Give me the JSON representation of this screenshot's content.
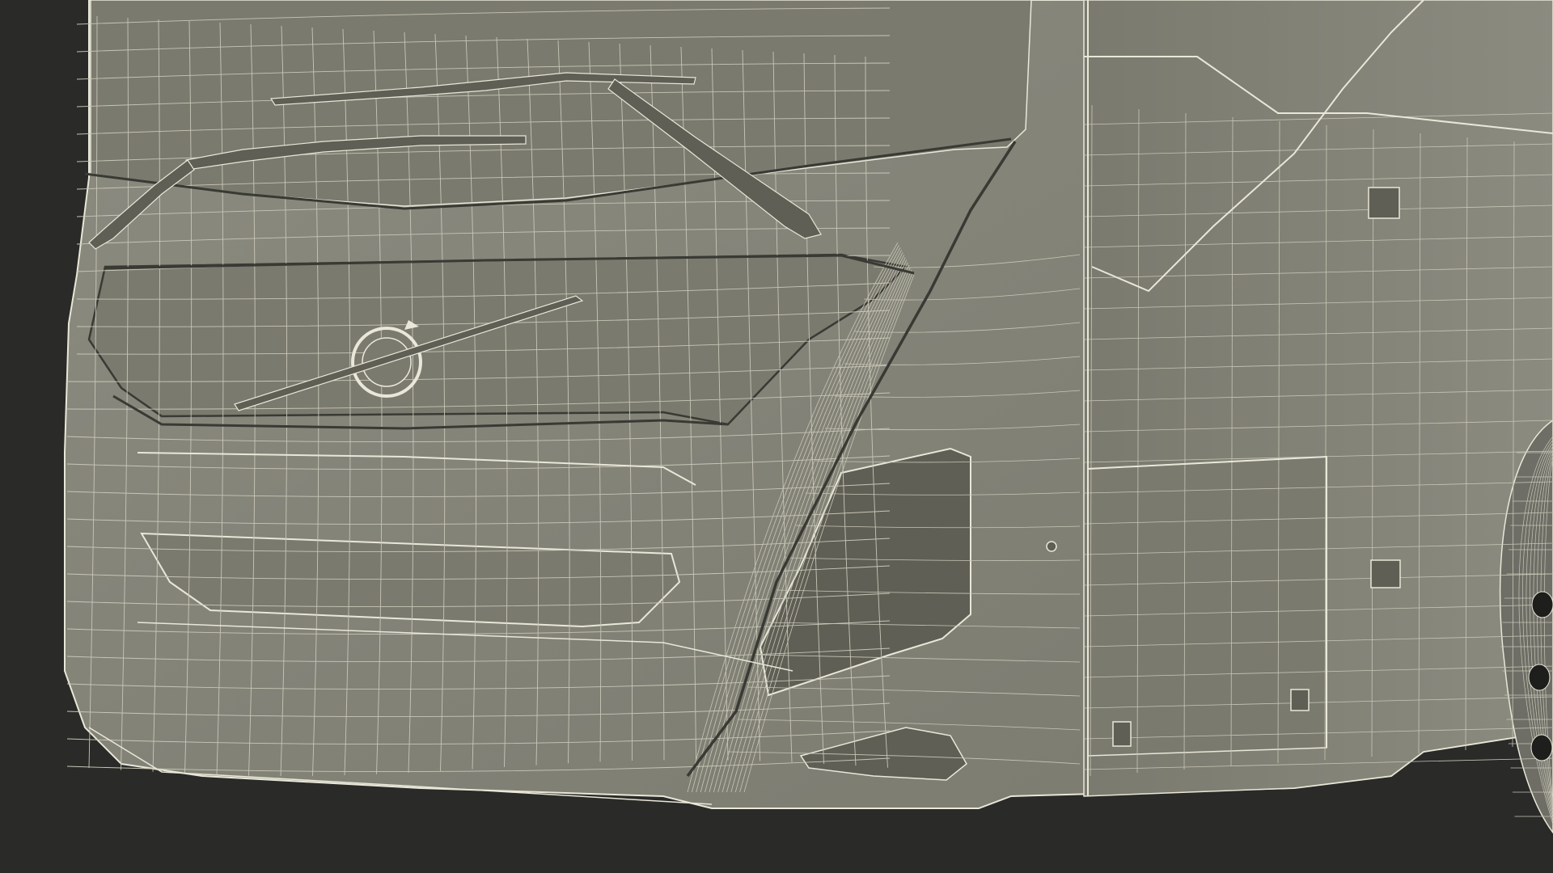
{
  "scene": {
    "subject": "bus-front-wireframe",
    "render_mode": "wireframe-on-shaded",
    "colors": {
      "background": "#2a2a29",
      "body_shade": "#7a7a6f",
      "body_shade_dark": "#5f5f56",
      "body_shade_light": "#8b8b80",
      "wire": "#e9e7d8",
      "wire_dim": "#c8c6b6",
      "crease": "#3a3a35",
      "tire": "#6e6e66"
    }
  }
}
